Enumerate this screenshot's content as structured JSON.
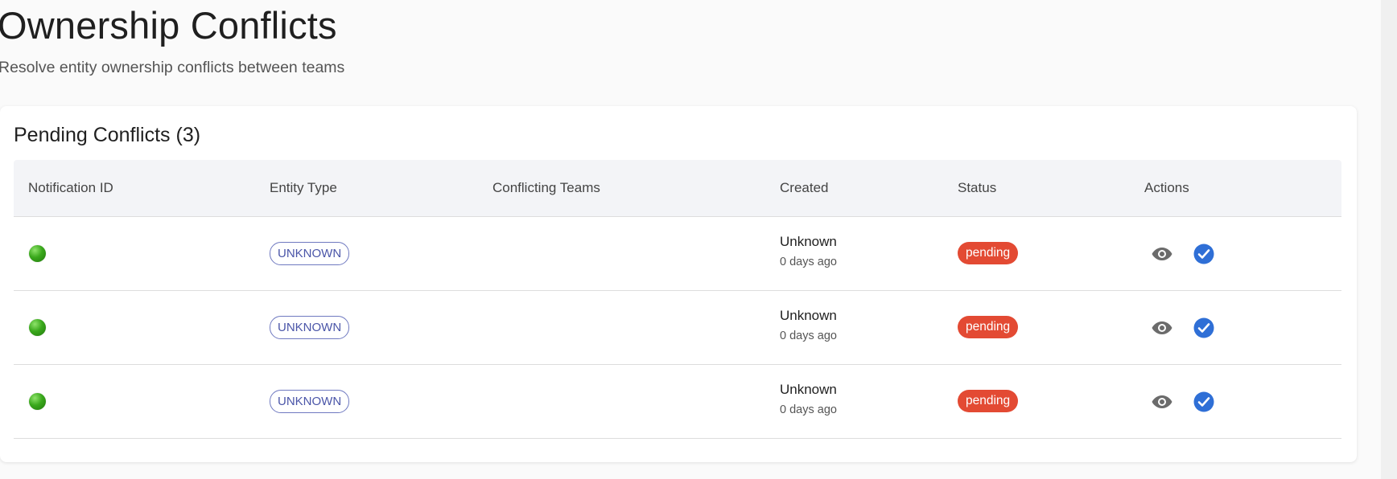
{
  "page": {
    "title": "Ownership Conflicts",
    "subtitle": "Resolve entity ownership conflicts between teams"
  },
  "card": {
    "title": "Pending Conflicts (3)"
  },
  "table": {
    "headers": {
      "notification_id": "Notification ID",
      "entity_type": "Entity Type",
      "conflicting_teams": "Conflicting Teams",
      "created": "Created",
      "status": "Status",
      "actions": "Actions"
    },
    "rows": [
      {
        "notification_icon": "green-status-dot-icon",
        "entity_type": "UNKNOWN",
        "conflicting_teams": "",
        "created_date": "Unknown",
        "created_relative": "0 days ago",
        "status": "pending",
        "actions": [
          "view-icon",
          "resolve-check-icon"
        ]
      },
      {
        "notification_icon": "green-status-dot-icon",
        "entity_type": "UNKNOWN",
        "conflicting_teams": "",
        "created_date": "Unknown",
        "created_relative": "0 days ago",
        "status": "pending",
        "actions": [
          "view-icon",
          "resolve-check-icon"
        ]
      },
      {
        "notification_icon": "green-status-dot-icon",
        "entity_type": "UNKNOWN",
        "conflicting_teams": "",
        "created_date": "Unknown",
        "created_relative": "0 days ago",
        "status": "pending",
        "actions": [
          "view-icon",
          "resolve-check-icon"
        ]
      }
    ]
  },
  "colors": {
    "status_pending": "#e34a33",
    "entity_chip": "#4a55a8",
    "resolve_icon": "#2f6fd6",
    "view_icon": "#6b6b6b",
    "status_dot": "#3aa81c",
    "header_bg": "#f3f4f7"
  }
}
